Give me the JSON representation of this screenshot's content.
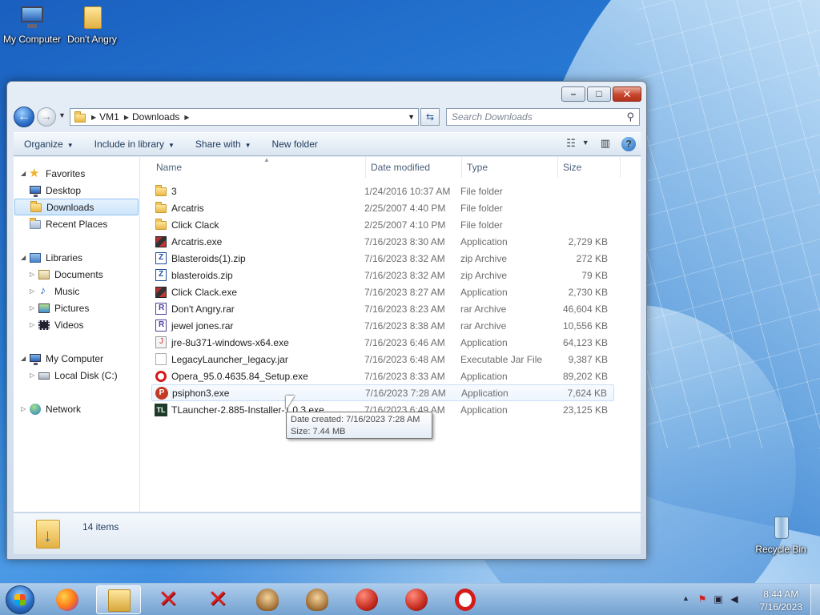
{
  "desktop": {
    "icons": [
      {
        "label": "My Computer",
        "icon": "computer-icon"
      },
      {
        "label": "Don't Angry",
        "icon": "folder-icon"
      },
      {
        "label": "Recycle Bin",
        "icon": "recycle-bin-icon"
      }
    ]
  },
  "window": {
    "caption_buttons": {
      "minimize": "–",
      "maximize": "□",
      "close": "✕"
    },
    "address": {
      "crumbs": [
        "VM1",
        "Downloads"
      ]
    },
    "search": {
      "placeholder": "Search Downloads"
    },
    "toolbar": {
      "organize": "Organize",
      "include_in_library": "Include in library",
      "share_with": "Share with",
      "new_folder": "New folder",
      "help": "?"
    },
    "nav_pane": {
      "favorites": "Favorites",
      "desktop": "Desktop",
      "downloads": "Downloads",
      "recent_places": "Recent Places",
      "libraries": "Libraries",
      "documents": "Documents",
      "music": "Music",
      "pictures": "Pictures",
      "videos": "Videos",
      "my_computer": "My Computer",
      "local_disk": "Local Disk (C:)",
      "network": "Network"
    },
    "columns": {
      "name": "Name",
      "date": "Date modified",
      "type": "Type",
      "size": "Size"
    },
    "files": [
      {
        "name": "3",
        "date": "1/24/2016 10:37 AM",
        "type": "File folder",
        "size": "",
        "icon": "folder-icon"
      },
      {
        "name": "Arcatris",
        "date": "2/25/2007 4:40 PM",
        "type": "File folder",
        "size": "",
        "icon": "folder-icon"
      },
      {
        "name": "Click Clack",
        "date": "2/25/2007 4:10 PM",
        "type": "File folder",
        "size": "",
        "icon": "folder-icon"
      },
      {
        "name": "Arcatris.exe",
        "date": "7/16/2023 8:30 AM",
        "type": "Application",
        "size": "2,729 KB",
        "icon": "exe-icon"
      },
      {
        "name": "Blasteroids(1).zip",
        "date": "7/16/2023 8:32 AM",
        "type": "zip Archive",
        "size": "272 KB",
        "icon": "zip-icon"
      },
      {
        "name": "blasteroids.zip",
        "date": "7/16/2023 8:32 AM",
        "type": "zip Archive",
        "size": "79 KB",
        "icon": "zip-icon"
      },
      {
        "name": "Click Clack.exe",
        "date": "7/16/2023 8:27 AM",
        "type": "Application",
        "size": "2,730 KB",
        "icon": "exe-icon"
      },
      {
        "name": "Don't Angry.rar",
        "date": "7/16/2023 8:23 AM",
        "type": "rar Archive",
        "size": "46,604 KB",
        "icon": "rar-icon"
      },
      {
        "name": "jewel jones.rar",
        "date": "7/16/2023 8:38 AM",
        "type": "rar Archive",
        "size": "10,556 KB",
        "icon": "rar-icon"
      },
      {
        "name": "jre-8u371-windows-x64.exe",
        "date": "7/16/2023 6:46 AM",
        "type": "Application",
        "size": "64,123 KB",
        "icon": "java-icon"
      },
      {
        "name": "LegacyLauncher_legacy.jar",
        "date": "7/16/2023 6:48 AM",
        "type": "Executable Jar File",
        "size": "9,387 KB",
        "icon": "jar-icon"
      },
      {
        "name": "Opera_95.0.4635.84_Setup.exe",
        "date": "7/16/2023 8:33 AM",
        "type": "Application",
        "size": "89,202 KB",
        "icon": "opera-icon"
      },
      {
        "name": "psiphon3.exe",
        "date": "7/16/2023 7:28 AM",
        "type": "Application",
        "size": "7,624 KB",
        "icon": "psiphon-icon"
      },
      {
        "name": "TLauncher-2.885-Installer-1.0.3.exe",
        "date": "7/16/2023 6:49 AM",
        "type": "Application",
        "size": "23,125 KB",
        "icon": "tlauncher-icon"
      }
    ],
    "tooltip": {
      "line1": "Date created: 7/16/2023 7:28 AM",
      "line2": "Size: 7.44 MB"
    },
    "details": {
      "count": "14 items"
    }
  },
  "taskbar": {
    "apps": [
      {
        "icon": "firefox-icon"
      },
      {
        "icon": "explorer-icon"
      },
      {
        "icon": "red-x-icon"
      },
      {
        "icon": "red-x-icon"
      },
      {
        "icon": "cowboy-icon"
      },
      {
        "icon": "cowboy-icon"
      },
      {
        "icon": "angry-bird-icon"
      },
      {
        "icon": "angry-bird-icon"
      },
      {
        "icon": "opera-icon"
      }
    ],
    "clock": {
      "time": "8:44 AM",
      "date": "7/16/2023"
    }
  }
}
